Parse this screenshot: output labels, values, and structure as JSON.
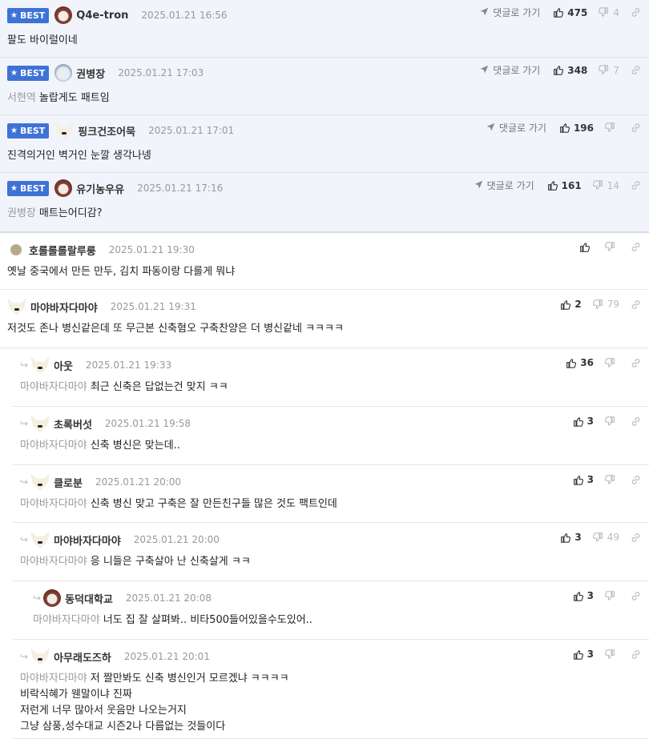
{
  "best_comments": [
    {
      "badge": "BEST",
      "nick": "Q4e-tron",
      "date": "2025.01.21 16:56",
      "mention": "",
      "text": "팔도 바이럴이네",
      "goto": "댓글로 가기",
      "likes": "475",
      "dislikes": "4",
      "avatar": "dog"
    },
    {
      "badge": "BEST",
      "nick": "권병장",
      "date": "2025.01.21 17:03",
      "mention": "서현역",
      "text": "놀랍게도 패트임",
      "goto": "댓글로 가기",
      "likes": "348",
      "dislikes": "7",
      "avatar": "rabbit"
    },
    {
      "badge": "BEST",
      "nick": "핑크건조어묵",
      "date": "2025.01.21 17:01",
      "mention": "",
      "text": "진격의거인 벽거인 눈깔 생각나넹",
      "goto": "댓글로 가기",
      "likes": "196",
      "dislikes": "",
      "avatar": "fox"
    },
    {
      "badge": "BEST",
      "nick": "유기농우유",
      "date": "2025.01.21 17:16",
      "mention": "권병장",
      "text": "매트는어디감?",
      "goto": "댓글로 가기",
      "likes": "161",
      "dislikes": "14",
      "avatar": "dog"
    }
  ],
  "comments": [
    {
      "nick": "호롤롤롤랄루룽",
      "date": "2025.01.21 19:30",
      "mention": "",
      "lines": [
        "옛날 중국에서 만든 만두, 김치 파동이랑 다를게 뭐냐"
      ],
      "likes": "",
      "dislikes": "",
      "avatar": "plain",
      "depth": 0
    },
    {
      "nick": "마야바자다마야",
      "date": "2025.01.21 19:31",
      "mention": "",
      "lines": [
        "저것도 존나 병신같은데 또 무근본 신축혐오 구축찬양은 더 병신같네 ㅋㅋㅋㅋ"
      ],
      "likes": "2",
      "dislikes": "79",
      "avatar": "fox",
      "depth": 0
    },
    {
      "nick": "아웃",
      "date": "2025.01.21 19:33",
      "mention": "마야바자다마야",
      "lines": [
        "최근 신축은 답없는건 맞지 ㅋㅋ"
      ],
      "likes": "36",
      "dislikes": "",
      "avatar": "fox",
      "depth": 1
    },
    {
      "nick": "초록버섯",
      "date": "2025.01.21 19:58",
      "mention": "마야바자다마야",
      "lines": [
        "신축 병신은 맞는데.."
      ],
      "likes": "3",
      "dislikes": "",
      "avatar": "fox",
      "depth": 1
    },
    {
      "nick": "클로분",
      "date": "2025.01.21 20:00",
      "mention": "마야바자다마야",
      "lines": [
        "신축 병신 맞고 구축은 잘 만든친구들 많은 것도 팩트인데"
      ],
      "likes": "3",
      "dislikes": "",
      "avatar": "fox",
      "depth": 1
    },
    {
      "nick": "마야바자다마야",
      "date": "2025.01.21 20:00",
      "mention": "마야바자다마야",
      "lines": [
        "응 니들은 구축살아 난 신축살게 ㅋㅋ"
      ],
      "likes": "3",
      "dislikes": "49",
      "avatar": "fox",
      "depth": 1
    },
    {
      "nick": "동덕대학교",
      "date": "2025.01.21 20:08",
      "mention": "마야바자다마야",
      "lines": [
        "너도 집 잘 살펴봐.. 비타500들어있을수도있어.."
      ],
      "likes": "3",
      "dislikes": "",
      "avatar": "dog",
      "depth": 2
    },
    {
      "nick": "아무래도즈하",
      "date": "2025.01.21 20:01",
      "mention": "마야바자다마야",
      "lines": [
        "저 짤만봐도 신축 병신인거 모르겠냐 ㅋㅋㅋㅋ",
        "비락식혜가 웬말이냐 진짜",
        "저런게 너무 많아서 웃음만 나오는거지",
        "그냥 삼풍,성수대교 시즌2나 다름없는 것들이다"
      ],
      "likes": "3",
      "dislikes": "",
      "avatar": "fox",
      "depth": 1
    }
  ]
}
